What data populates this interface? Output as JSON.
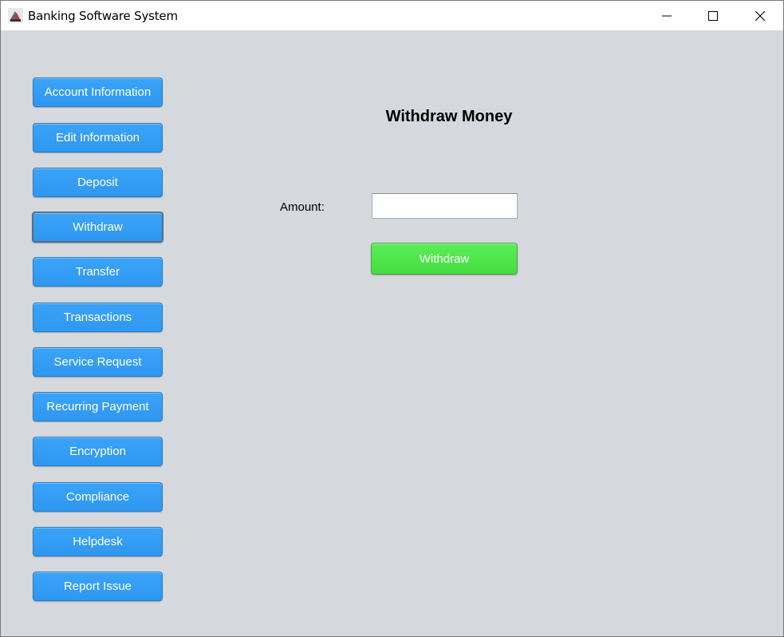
{
  "window": {
    "title": "Banking Software System",
    "controls": {
      "minimize_icon": "minimize-icon",
      "maximize_icon": "maximize-icon",
      "close_icon": "close-icon"
    }
  },
  "sidebar": {
    "items": [
      {
        "label": "Account Information",
        "active": false
      },
      {
        "label": "Edit Information",
        "active": false
      },
      {
        "label": "Deposit",
        "active": false
      },
      {
        "label": "Withdraw",
        "active": true
      },
      {
        "label": "Transfer",
        "active": false
      },
      {
        "label": "Transactions",
        "active": false
      },
      {
        "label": "Service Request",
        "active": false
      },
      {
        "label": "Recurring Payment",
        "active": false
      },
      {
        "label": "Encryption",
        "active": false
      },
      {
        "label": "Compliance",
        "active": false
      },
      {
        "label": "Helpdesk",
        "active": false
      },
      {
        "label": "Report Issue",
        "active": false
      }
    ]
  },
  "main": {
    "title": "Withdraw Money",
    "amount_label": "Amount:",
    "amount_value": "",
    "submit_label": "Withdraw"
  },
  "colors": {
    "background": "#d5d8dd",
    "sidebar_button": "#3399f3",
    "submit_button": "#4ee34a",
    "title_bar": "#ffffff"
  }
}
